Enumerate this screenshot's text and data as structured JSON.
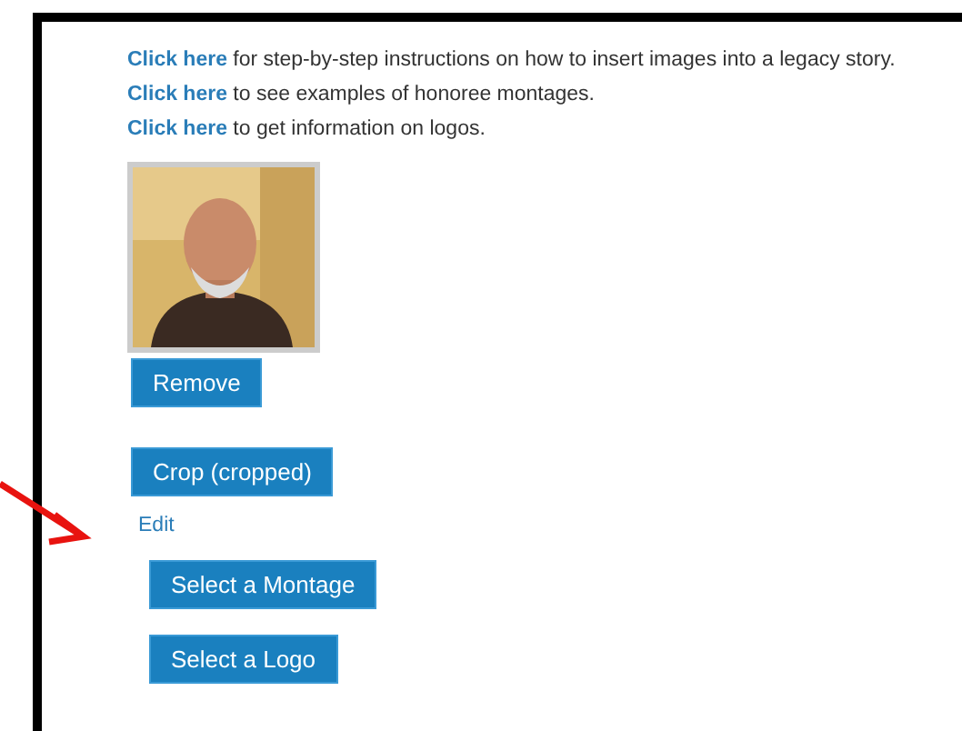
{
  "help_links": [
    {
      "link": "Click here",
      "text": " for step-by-step instructions on how to insert images into a legacy story."
    },
    {
      "link": "Click here",
      "text": " to see examples of honoree montages."
    },
    {
      "link": "Click here",
      "text": " to get information on logos."
    }
  ],
  "buttons": [
    {
      "kind": "button",
      "label": "Remove"
    },
    {
      "kind": "button",
      "label": "Crop (cropped)"
    },
    {
      "kind": "link",
      "label": "Edit"
    },
    {
      "kind": "button",
      "label": "Select a Montage"
    },
    {
      "kind": "button",
      "label": "Select a Logo"
    }
  ]
}
